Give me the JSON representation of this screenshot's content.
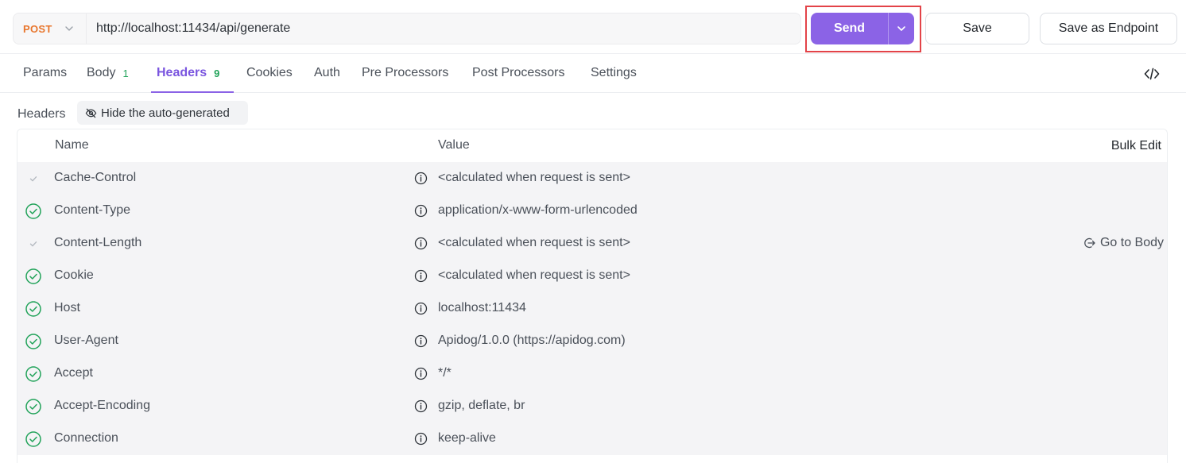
{
  "request": {
    "method": "POST",
    "url": "http://localhost:11434/api/generate",
    "method_color": "#e8762d"
  },
  "actions": {
    "send": "Send",
    "save": "Save",
    "save_as_endpoint": "Save as Endpoint",
    "accent_color": "#8b63e6",
    "highlight_color": "#e34348"
  },
  "tabs": [
    {
      "label": "Params",
      "count": ""
    },
    {
      "label": "Body",
      "count": "1"
    },
    {
      "label": "Headers",
      "count": "9",
      "active": true
    },
    {
      "label": "Cookies",
      "count": ""
    },
    {
      "label": "Auth",
      "count": ""
    },
    {
      "label": "Pre Processors",
      "count": ""
    },
    {
      "label": "Post Processors",
      "count": ""
    },
    {
      "label": "Settings",
      "count": ""
    }
  ],
  "headers_section": {
    "title": "Headers",
    "hide_toggle_label": "Hide the auto-generated",
    "columns": {
      "name": "Name",
      "value": "Value"
    },
    "bulk_edit": "Bulk Edit",
    "go_to_body": "Go to Body",
    "rows": [
      {
        "name": "Cache-Control",
        "value": "<calculated when request is sent>",
        "enabled": false
      },
      {
        "name": "Content-Type",
        "value": "application/x-www-form-urlencoded",
        "enabled": true
      },
      {
        "name": "Content-Length",
        "value": "<calculated when request is sent>",
        "enabled": false
      },
      {
        "name": "Cookie",
        "value": "<calculated when request is sent>",
        "enabled": true
      },
      {
        "name": "Host",
        "value": "localhost:11434",
        "enabled": true
      },
      {
        "name": "User-Agent",
        "value": "Apidog/1.0.0 (https://apidog.com)",
        "enabled": true
      },
      {
        "name": "Accept",
        "value": "*/*",
        "enabled": true
      },
      {
        "name": "Accept-Encoding",
        "value": "gzip, deflate, br",
        "enabled": true
      },
      {
        "name": "Connection",
        "value": "keep-alive",
        "enabled": true
      }
    ]
  },
  "icons": {
    "method_dropdown": "chevron-down-icon",
    "send_dropdown": "chevron-down-icon",
    "code": "code-icon",
    "hide": "eye-off-icon",
    "enabled": "check-circle-icon",
    "disabled": "check-icon",
    "info": "info-icon",
    "go_to_body": "redirect-icon"
  }
}
